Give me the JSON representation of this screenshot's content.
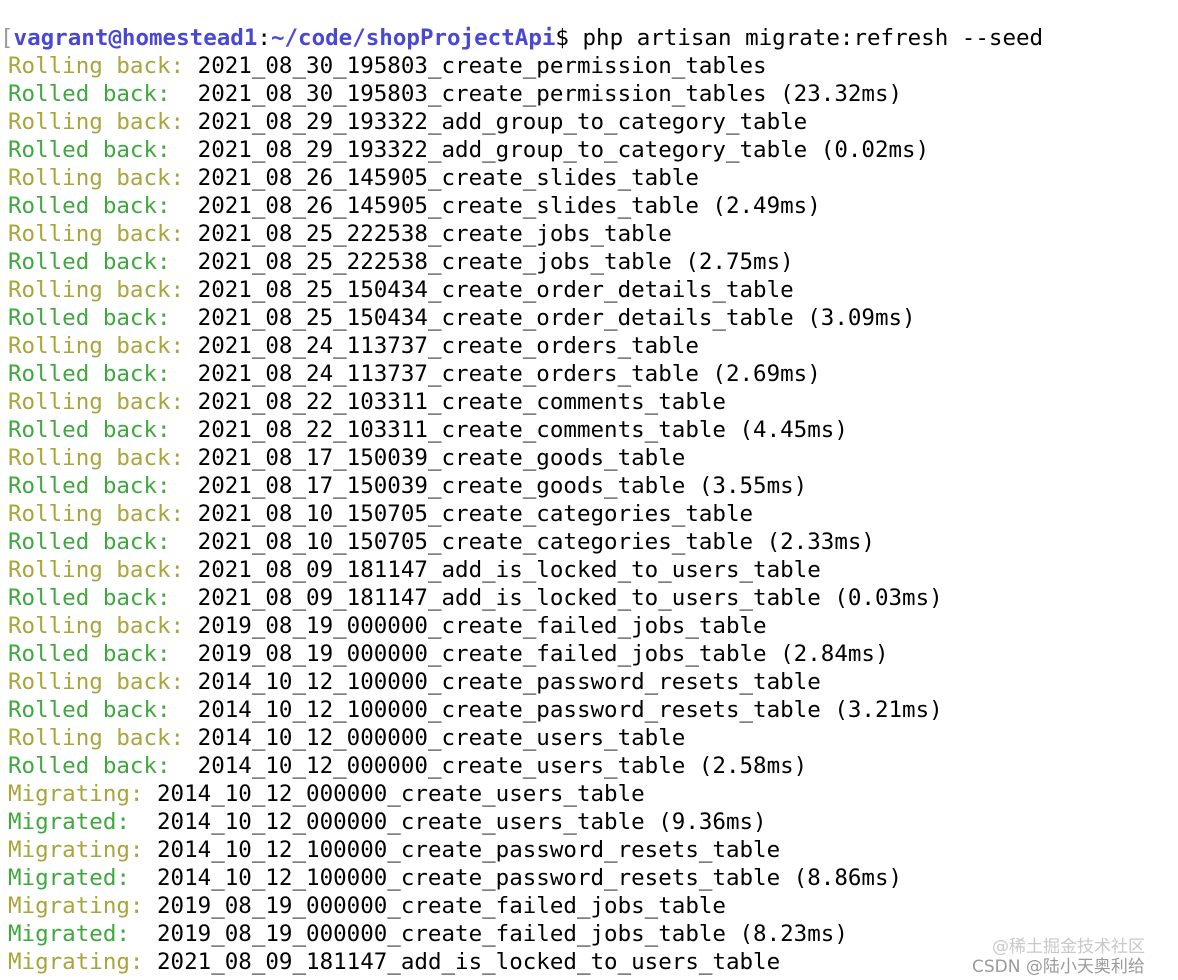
{
  "terminal": {
    "prompt": {
      "bracket": "[",
      "user_host": "vagrant@homestead1",
      "colon": ":",
      "path": "~/code/shopProjectApi",
      "symbol": "$",
      "command": " php artisan migrate:refresh --seed"
    },
    "lines": [
      {
        "kind": "rolling",
        "label": "Rolling back:",
        "text": " 2021_08_30_195803_create_permission_tables"
      },
      {
        "kind": "rolled",
        "label": "Rolled back:",
        "text": "  2021_08_30_195803_create_permission_tables (23.32ms)"
      },
      {
        "kind": "rolling",
        "label": "Rolling back:",
        "text": " 2021_08_29_193322_add_group_to_category_table"
      },
      {
        "kind": "rolled",
        "label": "Rolled back:",
        "text": "  2021_08_29_193322_add_group_to_category_table (0.02ms)"
      },
      {
        "kind": "rolling",
        "label": "Rolling back:",
        "text": " 2021_08_26_145905_create_slides_table"
      },
      {
        "kind": "rolled",
        "label": "Rolled back:",
        "text": "  2021_08_26_145905_create_slides_table (2.49ms)"
      },
      {
        "kind": "rolling",
        "label": "Rolling back:",
        "text": " 2021_08_25_222538_create_jobs_table"
      },
      {
        "kind": "rolled",
        "label": "Rolled back:",
        "text": "  2021_08_25_222538_create_jobs_table (2.75ms)"
      },
      {
        "kind": "rolling",
        "label": "Rolling back:",
        "text": " 2021_08_25_150434_create_order_details_table"
      },
      {
        "kind": "rolled",
        "label": "Rolled back:",
        "text": "  2021_08_25_150434_create_order_details_table (3.09ms)"
      },
      {
        "kind": "rolling",
        "label": "Rolling back:",
        "text": " 2021_08_24_113737_create_orders_table"
      },
      {
        "kind": "rolled",
        "label": "Rolled back:",
        "text": "  2021_08_24_113737_create_orders_table (2.69ms)"
      },
      {
        "kind": "rolling",
        "label": "Rolling back:",
        "text": " 2021_08_22_103311_create_comments_table"
      },
      {
        "kind": "rolled",
        "label": "Rolled back:",
        "text": "  2021_08_22_103311_create_comments_table (4.45ms)"
      },
      {
        "kind": "rolling",
        "label": "Rolling back:",
        "text": " 2021_08_17_150039_create_goods_table"
      },
      {
        "kind": "rolled",
        "label": "Rolled back:",
        "text": "  2021_08_17_150039_create_goods_table (3.55ms)"
      },
      {
        "kind": "rolling",
        "label": "Rolling back:",
        "text": " 2021_08_10_150705_create_categories_table"
      },
      {
        "kind": "rolled",
        "label": "Rolled back:",
        "text": "  2021_08_10_150705_create_categories_table (2.33ms)"
      },
      {
        "kind": "rolling",
        "label": "Rolling back:",
        "text": " 2021_08_09_181147_add_is_locked_to_users_table"
      },
      {
        "kind": "rolled",
        "label": "Rolled back:",
        "text": "  2021_08_09_181147_add_is_locked_to_users_table (0.03ms)"
      },
      {
        "kind": "rolling",
        "label": "Rolling back:",
        "text": " 2019_08_19_000000_create_failed_jobs_table"
      },
      {
        "kind": "rolled",
        "label": "Rolled back:",
        "text": "  2019_08_19_000000_create_failed_jobs_table (2.84ms)"
      },
      {
        "kind": "rolling",
        "label": "Rolling back:",
        "text": " 2014_10_12_100000_create_password_resets_table"
      },
      {
        "kind": "rolled",
        "label": "Rolled back:",
        "text": "  2014_10_12_100000_create_password_resets_table (3.21ms)"
      },
      {
        "kind": "rolling",
        "label": "Rolling back:",
        "text": " 2014_10_12_000000_create_users_table"
      },
      {
        "kind": "rolled",
        "label": "Rolled back:",
        "text": "  2014_10_12_000000_create_users_table (2.58ms)"
      },
      {
        "kind": "migrating",
        "label": "Migrating:",
        "text": " 2014_10_12_000000_create_users_table"
      },
      {
        "kind": "migrated",
        "label": "Migrated:",
        "text": "  2014_10_12_000000_create_users_table (9.36ms)"
      },
      {
        "kind": "migrating",
        "label": "Migrating:",
        "text": " 2014_10_12_100000_create_password_resets_table"
      },
      {
        "kind": "migrated",
        "label": "Migrated:",
        "text": "  2014_10_12_100000_create_password_resets_table (8.86ms)"
      },
      {
        "kind": "migrating",
        "label": "Migrating:",
        "text": " 2019_08_19_000000_create_failed_jobs_table"
      },
      {
        "kind": "migrated",
        "label": "Migrated:",
        "text": "  2019_08_19_000000_create_failed_jobs_table (8.23ms)"
      },
      {
        "kind": "migrating",
        "label": "Migrating:",
        "text": " 2021_08_09_181147_add_is_locked_to_users_table"
      }
    ]
  },
  "watermark": {
    "line1": "@稀土掘金技术社区",
    "line2": "CSDN @陆小天奥利给"
  },
  "colors": {
    "prompt": "#4b47d6",
    "rolling": "#a9a53b",
    "rolled": "#3ea83f",
    "text": "#000000",
    "background": "#ffffff"
  }
}
